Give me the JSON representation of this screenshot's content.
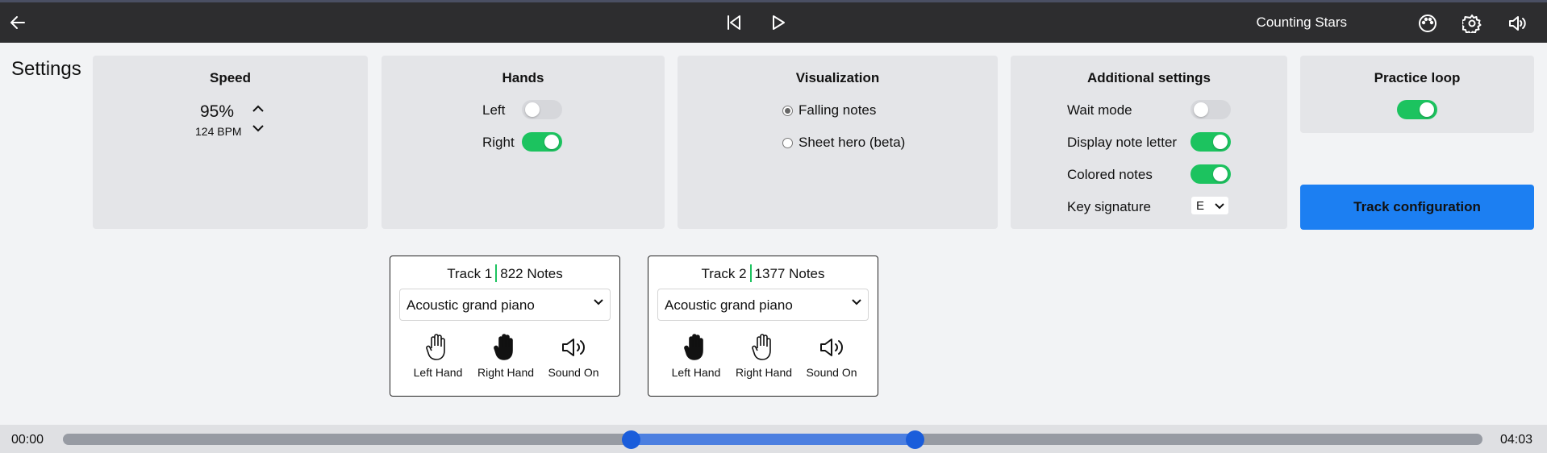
{
  "header": {
    "song_title": "Counting Stars",
    "icons": [
      "back-arrow-icon",
      "skip-back-icon",
      "play-icon",
      "palette-icon",
      "gear-icon",
      "volume-icon"
    ]
  },
  "settings_title": "Settings",
  "speed": {
    "title": "Speed",
    "percent": "95%",
    "bpm": "124 BPM"
  },
  "hands": {
    "title": "Hands",
    "left_label": "Left",
    "left_on": false,
    "right_label": "Right",
    "right_on": true
  },
  "visualization": {
    "title": "Visualization",
    "options": [
      "Falling notes",
      "Sheet hero (beta)"
    ],
    "selected": "Falling notes"
  },
  "additional": {
    "title": "Additional settings",
    "wait_mode": "Wait mode",
    "wait_mode_on": false,
    "display_note_letter": "Display note letter",
    "display_note_letter_on": true,
    "colored_notes": "Colored notes",
    "colored_notes_on": true,
    "key_signature": "Key signature",
    "key_value": "E"
  },
  "practice_loop": {
    "title": "Practice loop",
    "on": true,
    "track_config_label": "Track configuration"
  },
  "tracks": [
    {
      "name": "Track 1",
      "notes": "822 Notes",
      "instrument": "Acoustic grand piano",
      "left": "Left Hand",
      "right": "Right Hand",
      "sound": "Sound On"
    },
    {
      "name": "Track 2",
      "notes": "1377 Notes",
      "instrument": "Acoustic grand piano",
      "left": "Left Hand",
      "right": "Right Hand",
      "sound": "Sound On"
    }
  ],
  "timeline": {
    "start": "00:00",
    "end": "04:03",
    "loop_start_fraction": 0.4,
    "loop_end_fraction": 0.6
  },
  "colors": {
    "accent_green": "#1cc35f",
    "accent_blue": "#1c7ff2",
    "topbar": "#2d2d2f"
  }
}
